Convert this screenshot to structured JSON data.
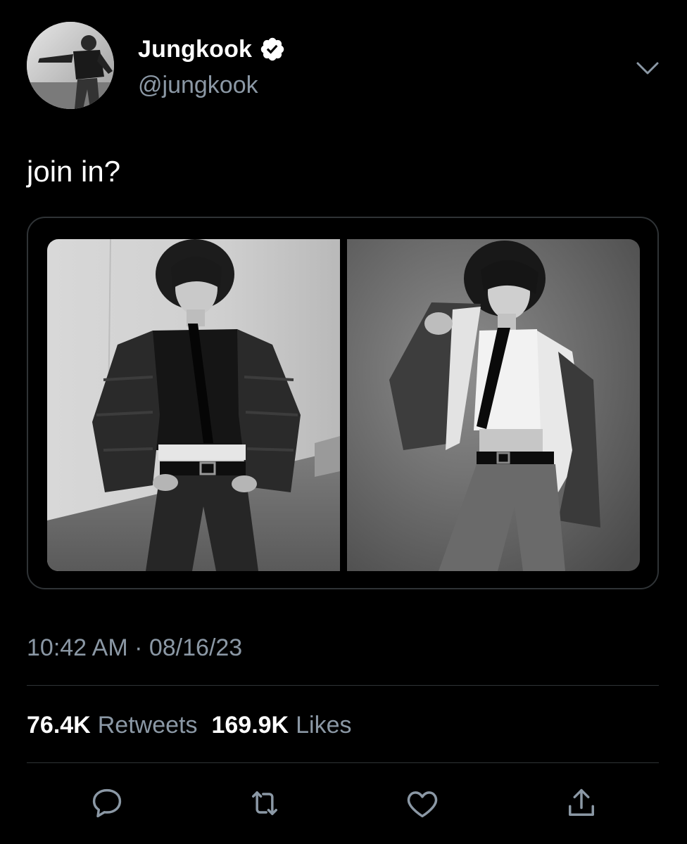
{
  "author": {
    "display_name": "Jungkook",
    "handle": "@jungkook",
    "verified": true,
    "avatar_icon": "profile-photo"
  },
  "tweet": {
    "text": "join in?",
    "media_count": 2,
    "timestamp": "10:42 AM · 08/16/23"
  },
  "stats": {
    "retweets_count": "76.4K",
    "retweets_label": "Retweets",
    "likes_count": "169.9K",
    "likes_label": "Likes"
  },
  "actions": [
    {
      "name": "reply",
      "icon": "speech-bubble-icon"
    },
    {
      "name": "retweet",
      "icon": "retweet-arrows-icon"
    },
    {
      "name": "like",
      "icon": "heart-icon"
    },
    {
      "name": "share",
      "icon": "share-upload-icon"
    }
  ],
  "colors": {
    "background": "#000000",
    "text": "#ffffff",
    "secondary_text": "#8b98a5",
    "divider": "#2f3336"
  }
}
